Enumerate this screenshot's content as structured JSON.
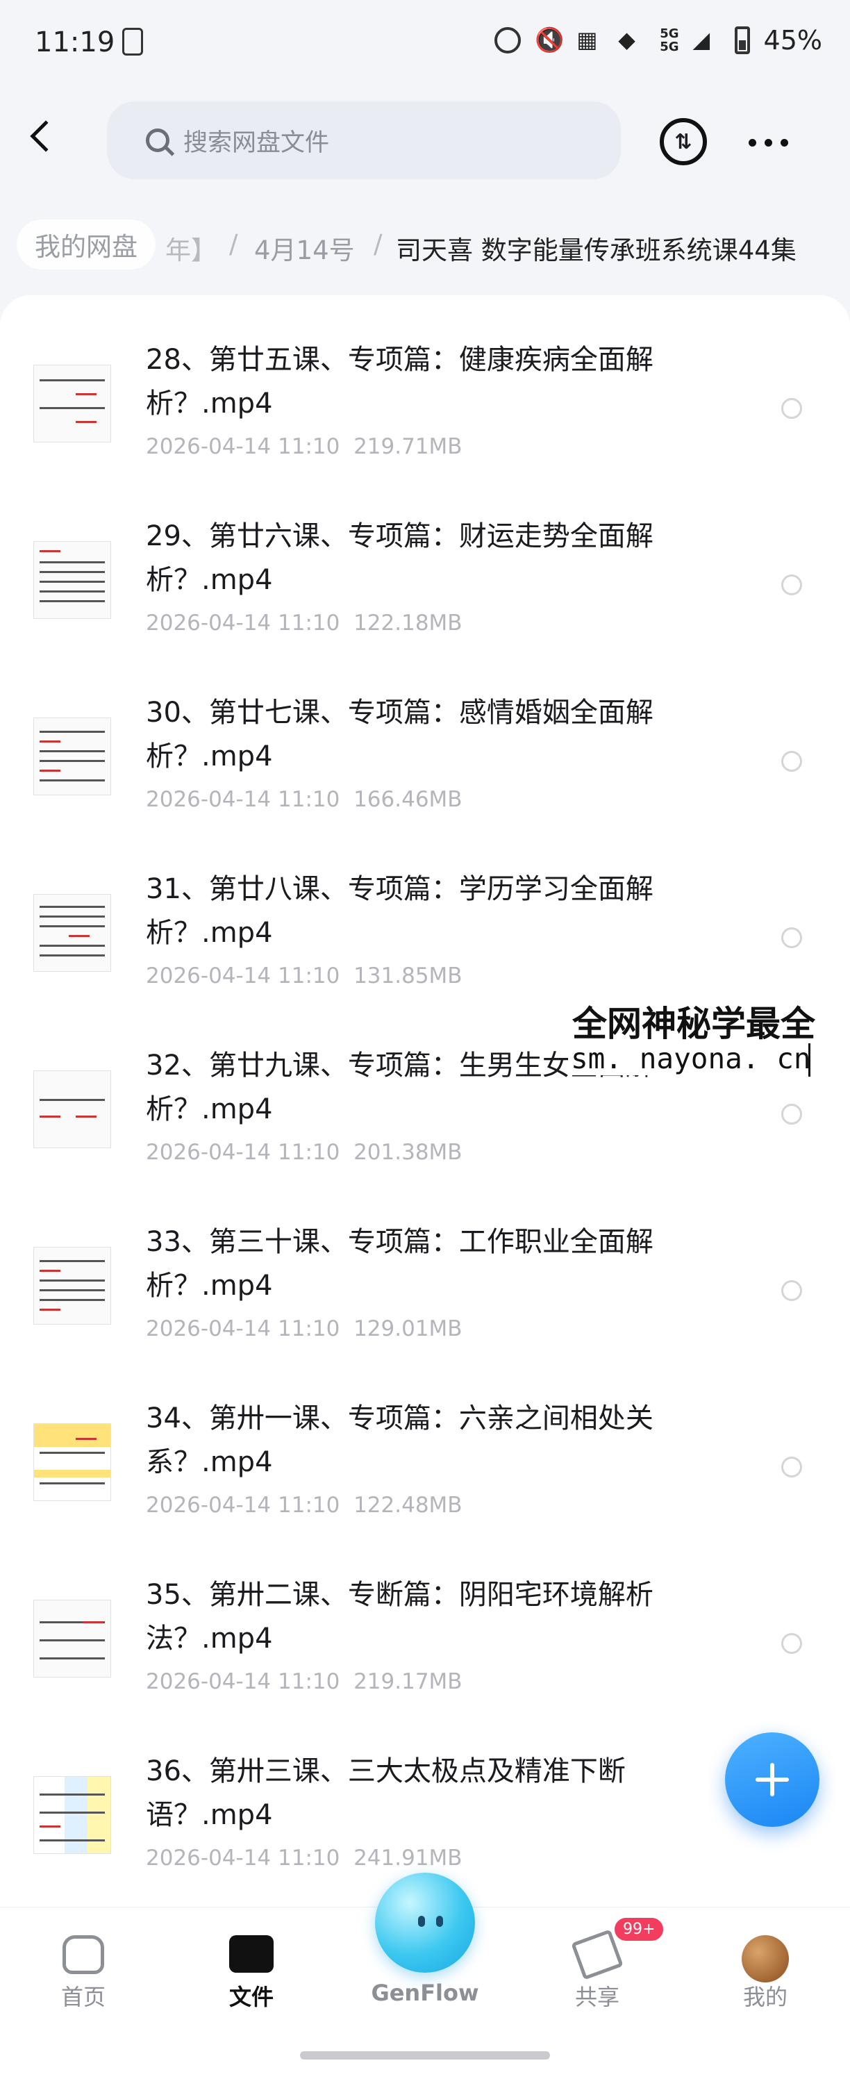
{
  "status_bar": {
    "time": "11:19",
    "network": "5G",
    "battery": "45%"
  },
  "search": {
    "placeholder": "搜索网盘文件"
  },
  "breadcrumb": {
    "home": "我的网盘",
    "fragment": "年】",
    "separator": "/",
    "folder": "4月14号",
    "current": "司天喜 数字能量传承班系统课44集"
  },
  "files": [
    {
      "name": "28、第廿五课、专项篇：健康疾病全面解析？.mp4",
      "date": "2026-04-14  11:10",
      "size": "219.71MB"
    },
    {
      "name": "29、第廿六课、专项篇：财运走势全面解析？.mp4",
      "date": "2026-04-14  11:10",
      "size": "122.18MB"
    },
    {
      "name": "30、第廿七课、专项篇：感情婚姻全面解析？.mp4",
      "date": "2026-04-14  11:10",
      "size": "166.46MB"
    },
    {
      "name": "31、第廿八课、专项篇：学历学习全面解析？.mp4",
      "date": "2026-04-14  11:10",
      "size": "131.85MB"
    },
    {
      "name": "32、第廿九课、专项篇：生男生女全面解析？.mp4",
      "date": "2026-04-14  11:10",
      "size": "201.38MB"
    },
    {
      "name": "33、第三十课、专项篇：工作职业全面解析？.mp4",
      "date": "2026-04-14  11:10",
      "size": "129.01MB"
    },
    {
      "name": "34、第卅一课、专项篇：六亲之间相处关系？.mp4",
      "date": "2026-04-14  11:10",
      "size": "122.48MB"
    },
    {
      "name": "35、第卅二课、专断篇：阴阳宅环境解析法？.mp4",
      "date": "2026-04-14  11:10",
      "size": "219.17MB"
    },
    {
      "name": "36、第卅三课、三大太极点及精准下断语？.mp4",
      "date": "2026-04-14  11:10",
      "size": "241.91MB"
    }
  ],
  "watermark": {
    "line1": "全网神秘学最全",
    "line2": "sm. nayona. cn"
  },
  "tabs": {
    "home": "首页",
    "files": "文件",
    "genflow": "GenFlow",
    "share": "共享",
    "share_badge": "99+",
    "me": "我的"
  },
  "accent": "#1b86f5"
}
